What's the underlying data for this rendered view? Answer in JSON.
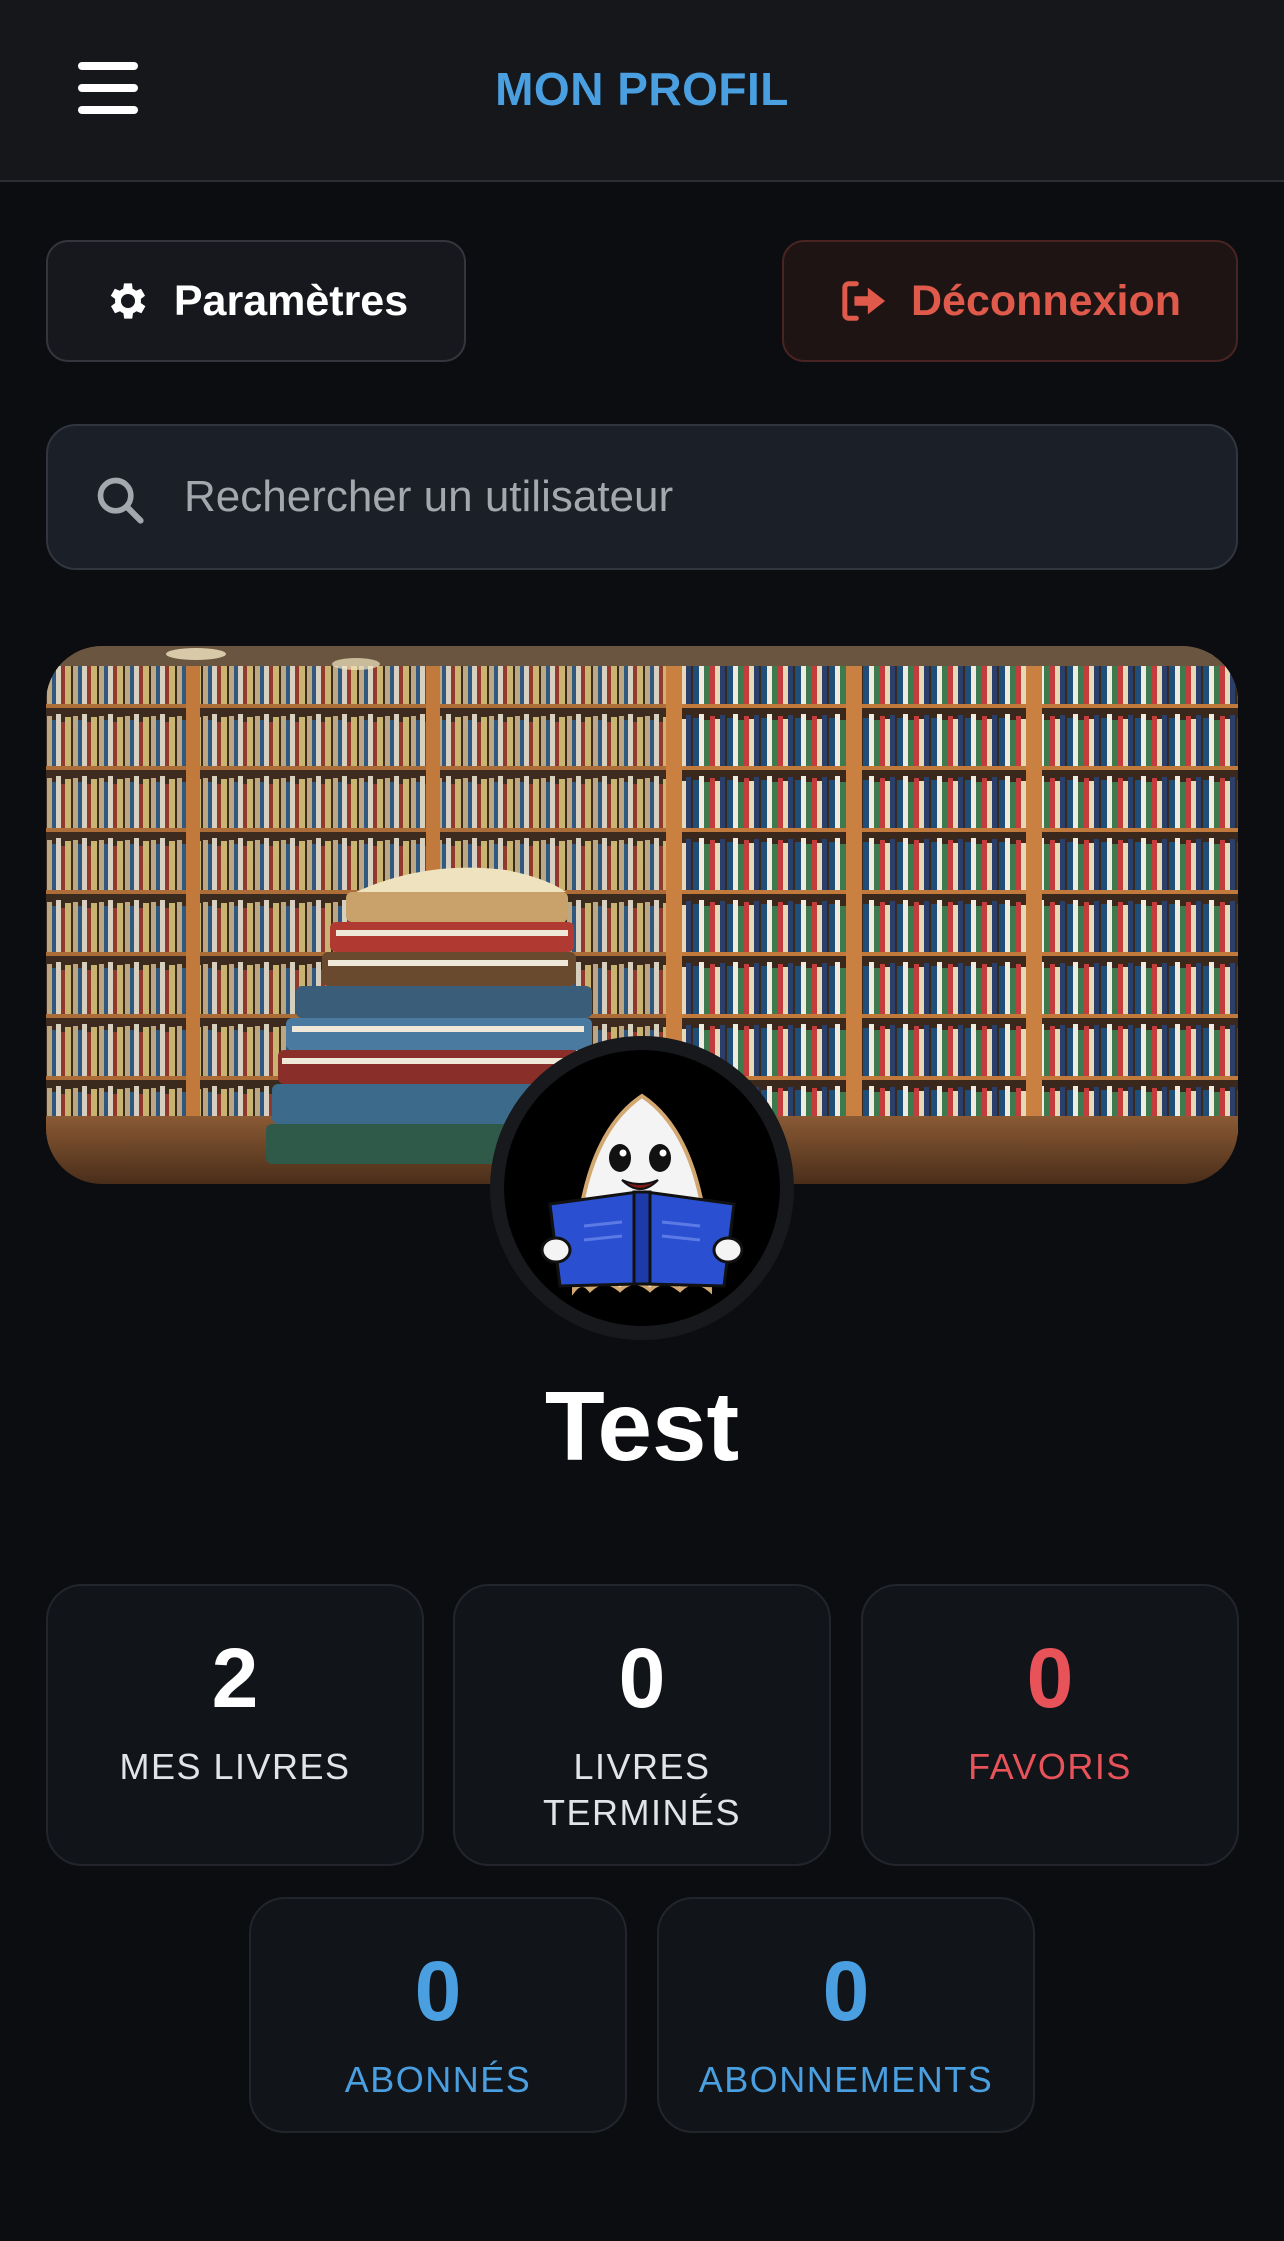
{
  "header": {
    "title": "MON PROFIL",
    "menu_icon": "hamburger-menu-icon"
  },
  "actions": {
    "settings_label": "Paramètres",
    "settings_icon": "gear-icon",
    "logout_label": "Déconnexion",
    "logout_icon": "sign-out-icon"
  },
  "search": {
    "placeholder": "Rechercher un utilisateur",
    "value": "",
    "icon": "search-icon"
  },
  "profile": {
    "username": "Test",
    "avatar": "ghost-reading-book-avatar",
    "banner": "library-bookshelves-banner"
  },
  "stats": [
    {
      "value": "2",
      "label": "MES LIVRES",
      "color": "#ffffff"
    },
    {
      "value": "0",
      "label": "LIVRES TERMINÉS",
      "color": "#ffffff"
    },
    {
      "value": "0",
      "label": "FAVORIS",
      "color": "#e8535a"
    },
    {
      "value": "0",
      "label": "ABONNÉS",
      "color": "#4a9fe0"
    },
    {
      "value": "0",
      "label": "ABONNEMENTS",
      "color": "#4a9fe0"
    }
  ],
  "colors": {
    "accent": "#4a9fe0",
    "danger": "#e05a4c",
    "background": "#0c0d10"
  }
}
